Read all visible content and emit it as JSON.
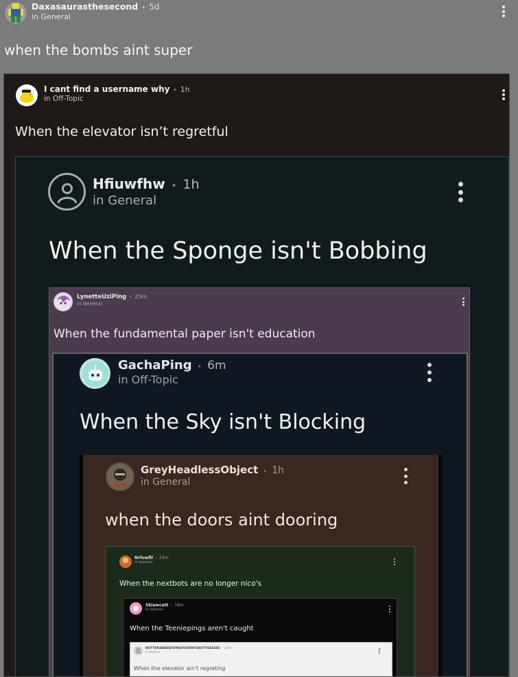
{
  "posts": [
    {
      "username": "Daxasaurasthesecond",
      "time": "5d",
      "category": "in General",
      "title": "when the bombs aint super"
    },
    {
      "username": "I cant find a username why",
      "time": "1h",
      "category": "in Off-Topic",
      "title": "When the elevator isn’t regretful"
    },
    {
      "username": "Hfiuwfhw",
      "time": "1h",
      "category": "in General",
      "title": "When the Sponge isn't Bobbing"
    },
    {
      "username": "LynetteUziPing",
      "time": "25m",
      "category": "in General",
      "title": "When the fundamental paper isn't education"
    },
    {
      "username": "GachaPing",
      "time": "6m",
      "category": "in Off-Topic",
      "title": "When the Sky isn't Blocking"
    },
    {
      "username": "GreyHeadlessObject",
      "time": "1h",
      "category": "in General",
      "title": "when the doors aint dooring"
    },
    {
      "username": "Nrfuwfil",
      "time": "23m",
      "category": "in General",
      "title": "When the nextbots are no longer nico's"
    },
    {
      "username": "Skiawcatt",
      "time": "18m",
      "category": "in General",
      "title": "When the Teeniepings aren't caught"
    },
    {
      "username": "BUTTERAWATATUMGIFEVENTSBUTTGEEEEE",
      "time": "12m",
      "category": "in General",
      "title": "When the elevator ain't regreting"
    }
  ],
  "separator": "•",
  "colors": {
    "page_bg": "#7b7b7b",
    "panel_dark_brown": "#1f1917",
    "panel_dark_teal": "#121b1c",
    "panel_purple": "#4a3c4d",
    "panel_navy": "#0f1720",
    "panel_brown": "#3b2722",
    "panel_green": "#1b2a1b",
    "panel_black": "#0a0a0a",
    "panel_white": "#f1f1f1"
  },
  "icons": [
    "roblox-avatar-icon",
    "duck-avatar-icon",
    "default-user-icon",
    "anime-avatar-icon",
    "robot-avatar-icon",
    "character-avatar-icon",
    "kebab-menu-icon"
  ]
}
